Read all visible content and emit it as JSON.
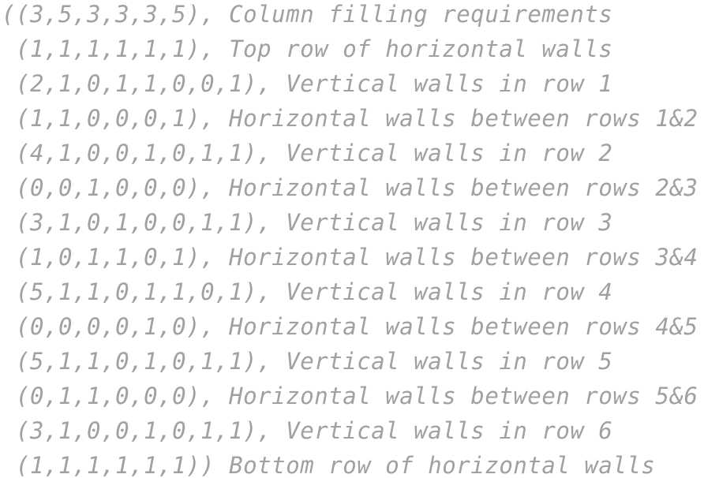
{
  "code": {
    "lines": [
      "((3,5,3,3,3,5), Column filling requirements",
      " (1,1,1,1,1,1), Top row of horizontal walls",
      " (2,1,0,1,1,0,0,1), Vertical walls in row 1",
      " (1,1,0,0,0,1), Horizontal walls between rows 1&2",
      " (4,1,0,0,1,0,1,1), Vertical walls in row 2",
      " (0,0,1,0,0,0), Horizontal walls between rows 2&3",
      " (3,1,0,1,0,0,1,1), Vertical walls in row 3",
      " (1,0,1,1,0,1), Horizontal walls between rows 3&4",
      " (5,1,1,0,1,1,0,1), Vertical walls in row 4",
      " (0,0,0,0,1,0), Horizontal walls between rows 4&5",
      " (5,1,1,0,1,0,1,1), Vertical walls in row 5",
      " (0,1,1,0,0,0), Horizontal walls between rows 5&6",
      " (3,1,0,0,1,0,1,1), Vertical walls in row 6",
      " (1,1,1,1,1,1)) Bottom row of horizontal walls"
    ],
    "text_color": "#a0a0a4",
    "background": "#ffffff"
  }
}
